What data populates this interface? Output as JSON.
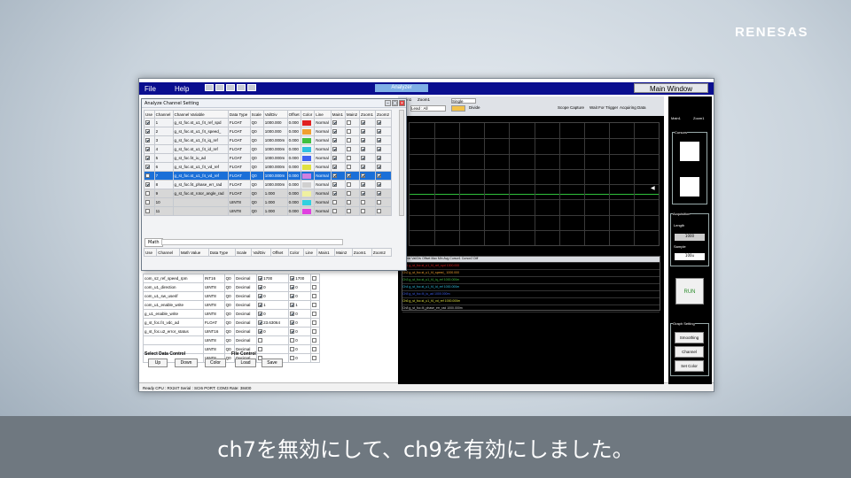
{
  "brand": {
    "logo": "RENESAS"
  },
  "caption": "ch7を無効にして、ch9を有効にしました。",
  "menubar": {
    "file": "File",
    "help": "Help",
    "analyze_tab": "Analyzer",
    "main_window": "Main Window"
  },
  "dialog": {
    "title": "Analyze Channel Setting",
    "headers": [
      "Use",
      "Channel",
      "Channel Variable",
      "Data Type",
      "Scale",
      "Val/Div",
      "Offset",
      "Color",
      "Line",
      "Main1",
      "Main2",
      "Zoom1",
      "Zoom2"
    ],
    "rows": [
      {
        "use": true,
        "ch": "1",
        "var": "g_st_foc.st_u1_f4_ref_spd",
        "type": "FLOAT",
        "scale": "Q0",
        "div": "1000.000",
        "off": "0.000",
        "color": "#e02020",
        "line": "Normal",
        "m1": true,
        "m2": false,
        "z1": true,
        "z2": true,
        "state": ""
      },
      {
        "use": true,
        "ch": "2",
        "var": "g_st_foc.st_u1_f4_speed_",
        "type": "FLOAT",
        "scale": "Q0",
        "div": "1000.000",
        "off": "0.000",
        "color": "#f0a030",
        "line": "Normal",
        "m1": true,
        "m2": false,
        "z1": true,
        "z2": true,
        "state": ""
      },
      {
        "use": true,
        "ch": "3",
        "var": "g_st_foc.st_u1_f4_iq_ref",
        "type": "FLOAT",
        "scale": "Q0",
        "div": "1000.000m",
        "off": "0.000",
        "color": "#40c040",
        "line": "Normal",
        "m1": true,
        "m2": false,
        "z1": true,
        "z2": true,
        "state": ""
      },
      {
        "use": true,
        "ch": "4",
        "var": "g_st_foc.st_u1_f4_id_ref",
        "type": "FLOAT",
        "scale": "Q0",
        "div": "1000.000m",
        "off": "0.000",
        "color": "#30c0e0",
        "line": "Normal",
        "m1": true,
        "m2": false,
        "z1": true,
        "z2": true,
        "state": ""
      },
      {
        "use": true,
        "ch": "5",
        "var": "g_st_foc.f4_iu_ad",
        "type": "FLOAT",
        "scale": "Q0",
        "div": "1000.000m",
        "off": "0.000",
        "color": "#4060f0",
        "line": "Normal",
        "m1": true,
        "m2": false,
        "z1": true,
        "z2": true,
        "state": ""
      },
      {
        "use": true,
        "ch": "6",
        "var": "g_st_foc.st_u1_f4_vd_ref",
        "type": "FLOAT",
        "scale": "Q0",
        "div": "1000.000m",
        "off": "0.000",
        "color": "#e0e040",
        "line": "Normal",
        "m1": true,
        "m2": false,
        "z1": true,
        "z2": true,
        "state": ""
      },
      {
        "use": false,
        "ch": "7",
        "var": "g_st_foc.st_u1_f4_vd_ref",
        "type": "FLOAT",
        "scale": "Q0",
        "div": "1000.000m",
        "off": "0.000",
        "color": "#d080e0",
        "line": "Normal",
        "m1": true,
        "m2": true,
        "z1": true,
        "z2": true,
        "state": "sel"
      },
      {
        "use": true,
        "ch": "8",
        "var": "g_st_foc.f4_phase_err_rad",
        "type": "FLOAT",
        "scale": "Q0",
        "div": "1000.000m",
        "off": "0.000",
        "color": "#d0d0d0",
        "line": "Normal",
        "m1": true,
        "m2": false,
        "z1": true,
        "z2": true,
        "state": ""
      },
      {
        "use": false,
        "ch": "9",
        "var": "g_st_foc.st_rotor_angle_rad",
        "type": "FLOAT",
        "scale": "Q0",
        "div": "1.000",
        "off": "0.000",
        "color": "#f0f0a0",
        "line": "Normal",
        "m1": true,
        "m2": false,
        "z1": true,
        "z2": true,
        "state": "dis"
      },
      {
        "use": false,
        "ch": "10",
        "var": "",
        "type": "UINT8",
        "scale": "Q0",
        "div": "1.000",
        "off": "0.000",
        "color": "#30d0e0",
        "line": "Normal",
        "m1": false,
        "m2": false,
        "z1": false,
        "z2": false,
        "state": "dis"
      },
      {
        "use": false,
        "ch": "11",
        "var": "",
        "type": "UINT8",
        "scale": "Q0",
        "div": "1.000",
        "off": "0.000",
        "color": "#e040e0",
        "line": "Normal",
        "m1": false,
        "m2": false,
        "z1": false,
        "z2": false,
        "state": "dis"
      }
    ],
    "math_label": "Math",
    "math_headers": [
      "Use",
      "Channel",
      "Math Value",
      "Data Type",
      "Scale",
      "Val/Div",
      "Offset",
      "Color",
      "Line",
      "Main1",
      "Main2",
      "Zoom1",
      "Zoom2"
    ]
  },
  "var_table": {
    "rows": [
      {
        "name": "com_s2_ref_speed_rpm",
        "type": "INT16",
        "scale": "Q0",
        "fmt": "Decimal",
        "w": "1700",
        "r": "1700"
      },
      {
        "name": "com_u1_direction",
        "type": "UINT8",
        "scale": "Q0",
        "fmt": "Decimal",
        "w": "0",
        "r": "0"
      },
      {
        "name": "com_u1_sw_userif",
        "type": "UINT8",
        "scale": "Q0",
        "fmt": "Decimal",
        "w": "0",
        "r": "0"
      },
      {
        "name": "com_u1_enable_write",
        "type": "UINT8",
        "scale": "Q0",
        "fmt": "Decimal",
        "w": "1",
        "r": "1"
      },
      {
        "name": "g_u1_enable_write",
        "type": "UINT8",
        "scale": "Q0",
        "fmt": "Decimal",
        "w": "0",
        "r": "0"
      },
      {
        "name": "g_st_foc.f4_vdc_ad",
        "type": "FLOAT",
        "scale": "Q0",
        "fmt": "Decimal",
        "w": "23.63064",
        "r": "0"
      },
      {
        "name": "g_st_foc.u2_error_status",
        "type": "UINT16",
        "scale": "Q0",
        "fmt": "Decimal",
        "w": "0",
        "r": "0"
      },
      {
        "name": "",
        "type": "UINT8",
        "scale": "Q0",
        "fmt": "Decimal",
        "w": "",
        "r": "0"
      },
      {
        "name": "",
        "type": "UINT8",
        "scale": "Q0",
        "fmt": "Decimal",
        "w": "",
        "r": "0"
      },
      {
        "name": "",
        "type": "UINT8",
        "scale": "Q0",
        "fmt": "Decimal",
        "w": "",
        "r": "0"
      }
    ],
    "select_group": "Select Data Control",
    "file_group": "File Control",
    "btn_up": "Up",
    "btn_down": "Down",
    "btn_color": "Color",
    "btn_load": "Load",
    "btn_save": "Save"
  },
  "status": "Ready  CPU : RX24T Serial : SCI6  PORT: COM3  Rate: 38400",
  "analyzer": {
    "tab_main": "Main1",
    "tab_zoom": "Zoom1",
    "scope_capture": "Scope Capture",
    "wait_trigger": "Wait For Trigger",
    "acquiring": "Acquiring Data",
    "trigger_mode": "Single",
    "channel_label": "Lead : All",
    "divide_label": "Divide",
    "table_headers": [
      "Name",
      "Val/Div",
      "Offset",
      "Max",
      "Min",
      "Avg",
      "Cursor1",
      "Cursor2",
      "Diff"
    ]
  },
  "sidebar": {
    "main1": "Main1",
    "zoom1": "Zoom1",
    "cursors": "Cursors",
    "acquisition": "Acquisition",
    "length": "Length",
    "sample": "Sample",
    "length_val": "1000",
    "sample_val": "100u",
    "run": "RUN",
    "graph_setting": "Graph Setting",
    "smoothing": "Smoothing",
    "channel_setting": "Channel Setting",
    "set_color": "Set Color"
  }
}
